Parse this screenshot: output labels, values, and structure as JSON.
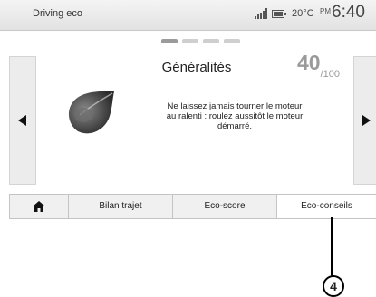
{
  "status_bar": {
    "title": "Driving eco",
    "temperature": "20°C",
    "ampm": "PM",
    "time": "6:40"
  },
  "pager": {
    "pages": 4,
    "active_index": 0
  },
  "content": {
    "title": "Généralités",
    "score_value": "40",
    "score_suffix": "/100",
    "advice_line1": "Ne laissez jamais tourner le moteur",
    "advice_line2": "au ralenti : roulez aussitôt le moteur",
    "advice_line3": "démarré."
  },
  "tabs": {
    "home_icon": "home-icon",
    "bilan": "Bilan trajet",
    "ecoscore": "Eco-score",
    "ecoconseils": "Eco-conseils",
    "selected": "ecoconseils"
  },
  "callout": {
    "label": "4"
  },
  "colors": {
    "score": "#9a9a9a",
    "tab_selected_bg": "#ffffff"
  }
}
